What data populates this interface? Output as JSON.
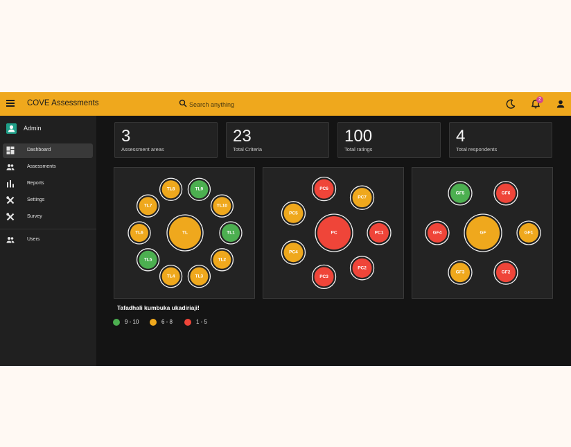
{
  "app": {
    "title": "COVE Assessments",
    "accent": "#efa81d",
    "search": {
      "placeholder": "Search anything"
    },
    "notifications": {
      "count": "2"
    }
  },
  "sidebar": {
    "user": "Admin",
    "items": [
      {
        "label": "Dashboard",
        "icon": "dashboard-icon",
        "active": true
      },
      {
        "label": "Assessments",
        "icon": "people-icon"
      },
      {
        "label": "Reports",
        "icon": "bar-chart-icon"
      },
      {
        "label": "Settings",
        "icon": "tools-icon"
      },
      {
        "label": "Survey",
        "icon": "tools-icon"
      },
      {
        "label": "Users",
        "icon": "people-icon"
      }
    ]
  },
  "stats": [
    {
      "value": "3",
      "label": "Assessment areas"
    },
    {
      "value": "23",
      "label": "Total Criteria"
    },
    {
      "value": "100",
      "label": "Total ratings"
    },
    {
      "value": "4",
      "label": "Total respondents"
    }
  ],
  "colors": {
    "high": "#4caf50",
    "mid": "#efa81d",
    "low": "#ef4539"
  },
  "areas": [
    {
      "center": {
        "label": "TL",
        "level": "mid"
      },
      "criteria": [
        {
          "label": "TL1",
          "level": "high"
        },
        {
          "label": "TL2",
          "level": "mid"
        },
        {
          "label": "TL3",
          "level": "mid"
        },
        {
          "label": "TL4",
          "level": "mid"
        },
        {
          "label": "TL5",
          "level": "high"
        },
        {
          "label": "TL6",
          "level": "mid"
        },
        {
          "label": "TL7",
          "level": "mid"
        },
        {
          "label": "TL8",
          "level": "mid"
        },
        {
          "label": "TL9",
          "level": "high"
        },
        {
          "label": "TL10",
          "level": "mid"
        }
      ]
    },
    {
      "center": {
        "label": "PC",
        "level": "low"
      },
      "criteria": [
        {
          "label": "PC1",
          "level": "low"
        },
        {
          "label": "PC2",
          "level": "low"
        },
        {
          "label": "PC3",
          "level": "low"
        },
        {
          "label": "PC4",
          "level": "mid"
        },
        {
          "label": "PC5",
          "level": "mid"
        },
        {
          "label": "PC6",
          "level": "low"
        },
        {
          "label": "PC7",
          "level": "mid"
        }
      ]
    },
    {
      "center": {
        "label": "GF",
        "level": "mid"
      },
      "criteria": [
        {
          "label": "GF1",
          "level": "mid"
        },
        {
          "label": "GF2",
          "level": "low"
        },
        {
          "label": "GF3",
          "level": "mid"
        },
        {
          "label": "GF4",
          "level": "low"
        },
        {
          "label": "GF5",
          "level": "high"
        },
        {
          "label": "GF6",
          "level": "low"
        }
      ]
    }
  ],
  "legend": {
    "title": "Tafadhali kumbuka ukadiriaji!",
    "items": [
      {
        "label": "9 - 10",
        "level": "high"
      },
      {
        "label": "6 - 8",
        "level": "mid"
      },
      {
        "label": "1 - 5",
        "level": "low"
      }
    ]
  }
}
